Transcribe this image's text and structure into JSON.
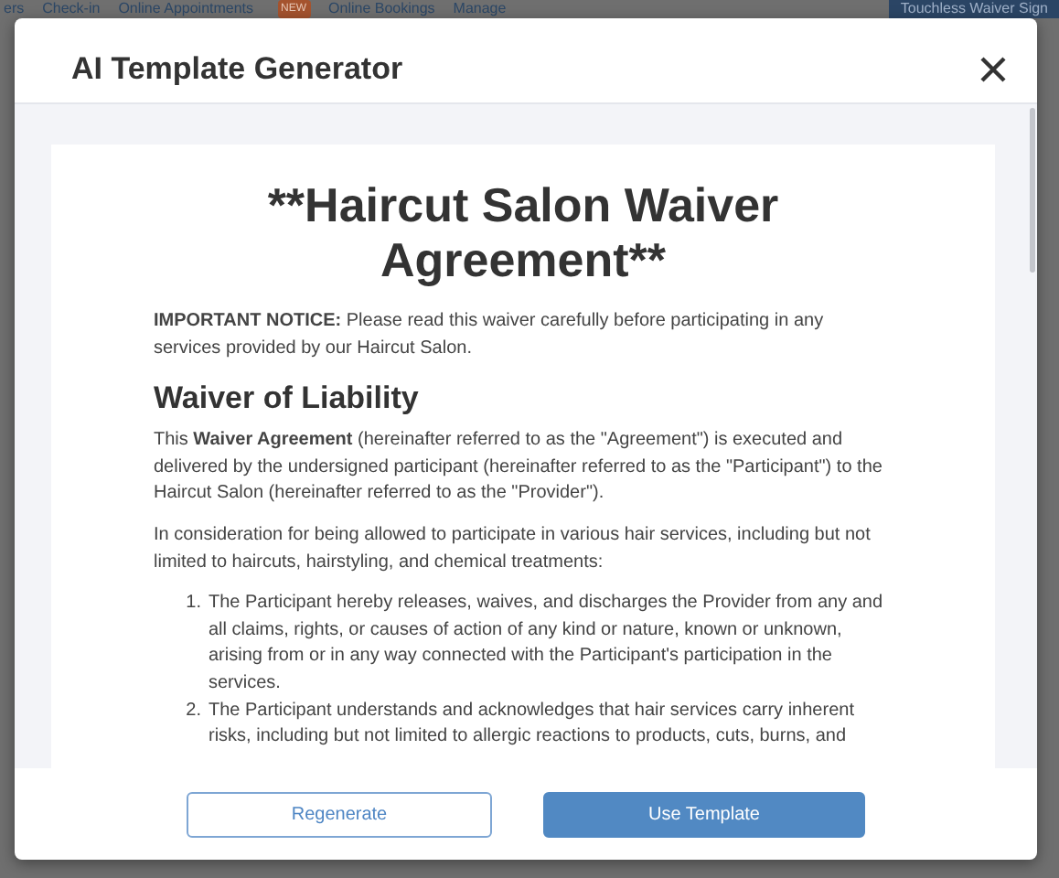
{
  "background_nav": {
    "items": [
      {
        "label": "ers"
      },
      {
        "label": "Check-in"
      },
      {
        "label": "Online Appointments",
        "badge": "NEW"
      },
      {
        "label": "Online Bookings"
      },
      {
        "label": "Manage"
      }
    ],
    "button": "Touchless Waiver Sign"
  },
  "dialog": {
    "title": "AI Template Generator",
    "document": {
      "title": "**Haircut Salon Waiver Agreement**",
      "blocks": [
        {
          "kind": "paragraph",
          "text": "**IMPORTANT NOTICE:** Please read this waiver carefully before participating in any services provided by our Haircut Salon."
        },
        {
          "kind": "heading",
          "text": "Waiver of Liability"
        },
        {
          "kind": "paragraph",
          "text": "This **Waiver Agreement** (hereinafter referred to as the \"Agreement\") is executed and delivered by the undersigned participant (hereinafter referred to as the \"Participant\") to the Haircut Salon (hereinafter referred to as the \"Provider\")."
        },
        {
          "kind": "paragraph",
          "text": "In consideration for being allowed to participate in various hair services, including but not limited to haircuts, hairstyling, and chemical treatments:"
        },
        {
          "kind": "list",
          "items": [
            {
              "marker": "1.",
              "text": "The Participant hereby releases, waives, and discharges the Provider from any and all claims, rights, or causes of action of any kind or nature, known or unknown, arising from or in any way connected with the Participant's participation in the services."
            },
            {
              "marker": "2.",
              "text": "The Participant understands and acknowledges that hair services carry inherent risks, including but not limited to allergic reactions to products, cuts, burns, and"
            }
          ]
        }
      ]
    },
    "buttons": [
      {
        "label": "Regenerate",
        "kind": "secondary"
      },
      {
        "label": "Use Template",
        "kind": "primary"
      }
    ]
  }
}
